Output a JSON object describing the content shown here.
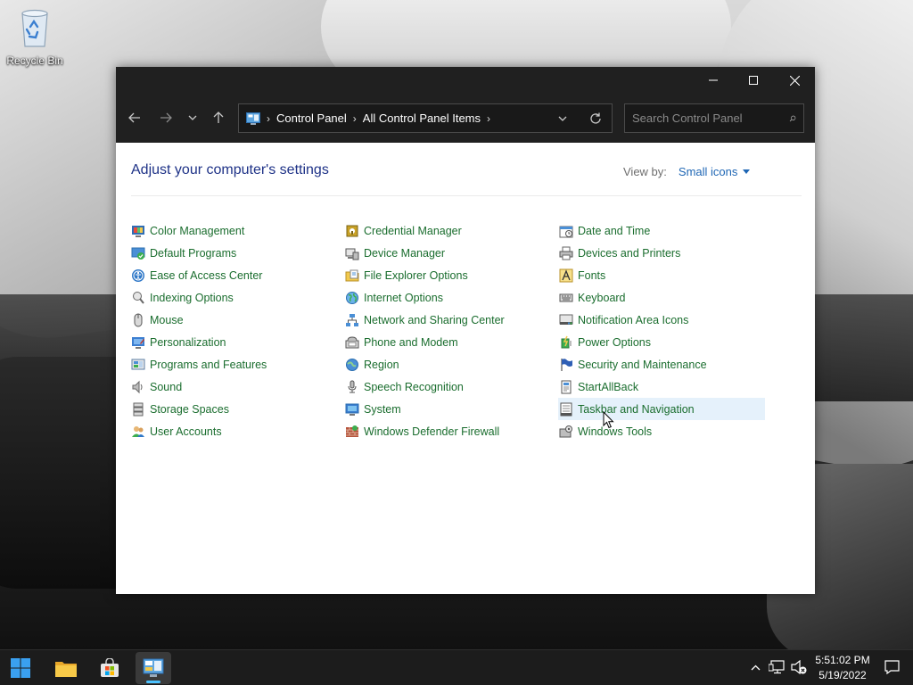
{
  "desktop": {
    "recycle_bin_label": "Recycle Bin"
  },
  "window": {
    "breadcrumb": [
      "Control Panel",
      "All Control Panel Items"
    ],
    "search_placeholder": "Search Control Panel",
    "heading": "Adjust your computer's settings",
    "view_by_label": "View by:",
    "view_by_value": "Small icons",
    "columns": [
      [
        {
          "label": "Color Management",
          "icon": "color-management-icon"
        },
        {
          "label": "Default Programs",
          "icon": "default-programs-icon"
        },
        {
          "label": "Ease of Access Center",
          "icon": "ease-of-access-icon"
        },
        {
          "label": "Indexing Options",
          "icon": "indexing-options-icon"
        },
        {
          "label": "Mouse",
          "icon": "mouse-icon"
        },
        {
          "label": "Personalization",
          "icon": "personalization-icon"
        },
        {
          "label": "Programs and Features",
          "icon": "programs-features-icon"
        },
        {
          "label": "Sound",
          "icon": "sound-icon"
        },
        {
          "label": "Storage Spaces",
          "icon": "storage-spaces-icon"
        },
        {
          "label": "User Accounts",
          "icon": "user-accounts-icon"
        }
      ],
      [
        {
          "label": "Credential Manager",
          "icon": "credential-manager-icon"
        },
        {
          "label": "Device Manager",
          "icon": "device-manager-icon"
        },
        {
          "label": "File Explorer Options",
          "icon": "folder-options-icon"
        },
        {
          "label": "Internet Options",
          "icon": "internet-options-icon"
        },
        {
          "label": "Network and Sharing Center",
          "icon": "network-icon"
        },
        {
          "label": "Phone and Modem",
          "icon": "phone-modem-icon"
        },
        {
          "label": "Region",
          "icon": "region-icon"
        },
        {
          "label": "Speech Recognition",
          "icon": "microphone-icon"
        },
        {
          "label": "System",
          "icon": "system-icon"
        },
        {
          "label": "Windows Defender Firewall",
          "icon": "firewall-icon"
        }
      ],
      [
        {
          "label": "Date and Time",
          "icon": "date-time-icon"
        },
        {
          "label": "Devices and Printers",
          "icon": "printer-icon"
        },
        {
          "label": "Fonts",
          "icon": "fonts-icon"
        },
        {
          "label": "Keyboard",
          "icon": "keyboard-icon"
        },
        {
          "label": "Notification Area Icons",
          "icon": "notification-area-icon"
        },
        {
          "label": "Power Options",
          "icon": "power-options-icon"
        },
        {
          "label": "Security and Maintenance",
          "icon": "flag-icon"
        },
        {
          "label": "StartAllBack",
          "icon": "startallback-icon"
        },
        {
          "label": "Taskbar and Navigation",
          "icon": "taskbar-icon",
          "highlighted": true
        },
        {
          "label": "Windows Tools",
          "icon": "windows-tools-icon"
        }
      ]
    ]
  },
  "taskbar": {
    "apps": [
      "start-icon",
      "file-explorer-icon",
      "store-icon",
      "control-panel-icon"
    ],
    "time": "5:51:02 PM",
    "date": "5/19/2022"
  },
  "colors": {
    "link_green": "#1a6d2e",
    "heading_blue": "#1e3287",
    "view_by_blue": "#1e66b4",
    "title_bar": "#202020",
    "highlight": "#e5f1fb",
    "accent": "#4cc2ff"
  }
}
